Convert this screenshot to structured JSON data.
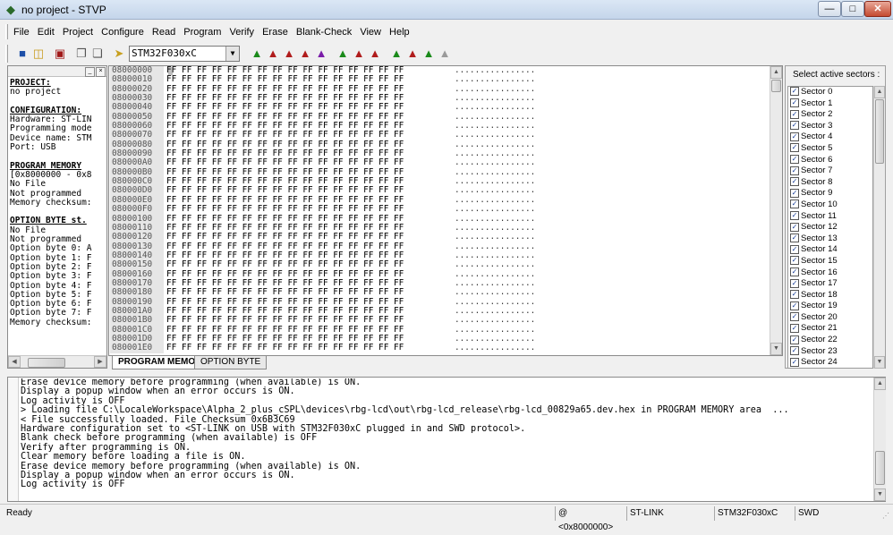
{
  "window": {
    "title": "no project - STVP"
  },
  "menu": [
    "File",
    "Edit",
    "Project",
    "Configure",
    "Read",
    "Program",
    "Verify",
    "Erase",
    "Blank-Check",
    "View",
    "Help"
  ],
  "toolbar": {
    "device": "STM32F030xC"
  },
  "icons": {
    "save": "save-icon",
    "open": "open-icon",
    "chip": "chip-icon",
    "copy": "copy-icon",
    "paste": "paste-icon",
    "connect": "connect-icon"
  },
  "left_panel": {
    "lines": [
      {
        "t": "PROJECT:",
        "h": true
      },
      {
        "t": "no project"
      },
      {
        "t": ""
      },
      {
        "t": "CONFIGURATION:",
        "h": true
      },
      {
        "t": "Hardware: ST-LIN"
      },
      {
        "t": "Programming mode"
      },
      {
        "t": "Device name: STM"
      },
      {
        "t": "Port: USB"
      },
      {
        "t": ""
      },
      {
        "t": "PROGRAM MEMORY",
        "h": true
      },
      {
        "t": "[0x8000000 - 0x8"
      },
      {
        "t": "No File"
      },
      {
        "t": "Not programmed"
      },
      {
        "t": "Memory checksum:"
      },
      {
        "t": ""
      },
      {
        "t": "OPTION BYTE st.",
        "h": true
      },
      {
        "t": "No File"
      },
      {
        "t": "Not programmed"
      },
      {
        "t": "Option byte 0: A"
      },
      {
        "t": "Option byte 1: F"
      },
      {
        "t": "Option byte 2: F"
      },
      {
        "t": "Option byte 3: F"
      },
      {
        "t": "Option byte 4: F"
      },
      {
        "t": "Option byte 5: F"
      },
      {
        "t": "Option byte 6: F"
      },
      {
        "t": "Option byte 7: F"
      },
      {
        "t": "Memory checksum:"
      }
    ]
  },
  "hex": {
    "addresses": [
      "08000000",
      "08000010",
      "08000020",
      "08000030",
      "08000040",
      "08000050",
      "08000060",
      "08000070",
      "08000080",
      "08000090",
      "080000A0",
      "080000B0",
      "080000C0",
      "080000D0",
      "080000E0",
      "080000F0",
      "08000100",
      "08000110",
      "08000120",
      "08000130",
      "08000140",
      "08000150",
      "08000160",
      "08000170",
      "08000180",
      "08000190",
      "080001A0",
      "080001B0",
      "080001C0",
      "080001D0",
      "080001E0"
    ],
    "data_line": "FF FF FF FF FF FF FF FF FF FF FF FF FF FF FF FF",
    "ascii_line": "................"
  },
  "tabs": [
    "PROGRAM MEMORY",
    "OPTION BYTE"
  ],
  "sectors": {
    "label": "Select active sectors :",
    "items": [
      "Sector 0",
      "Sector 1",
      "Sector 2",
      "Sector 3",
      "Sector 4",
      "Sector 5",
      "Sector 6",
      "Sector 7",
      "Sector 8",
      "Sector 9",
      "Sector 10",
      "Sector 11",
      "Sector 12",
      "Sector 13",
      "Sector 14",
      "Sector 15",
      "Sector 16",
      "Sector 17",
      "Sector 18",
      "Sector 19",
      "Sector 20",
      "Sector 21",
      "Sector 22",
      "Sector 23",
      "Sector 24"
    ]
  },
  "log": [
    "Erase device memory before programming (when available) is ON.",
    "Display a popup window when an error occurs is ON.",
    "Log activity is OFF",
    "> Loading file C:\\LocaleWorkspace\\Alpha_2_plus_cSPL\\devices\\rbg-lcd\\out\\rbg-lcd_release\\rbg-lcd_00829a65.dev.hex in PROGRAM MEMORY area  ...",
    "< File successfully loaded. File Checksum 0x6B3C69",
    "Hardware configuration set to <ST-LINK on USB with STM32F030xC plugged in and SWD protocol>.",
    "Blank check before programming (when available) is OFF",
    "Verify after programming is ON.",
    "Clear memory before loading a file is ON.",
    "Erase device memory before programming (when available) is ON.",
    "Display a popup window when an error occurs is ON.",
    "Log activity is OFF"
  ],
  "status": {
    "ready": "Ready",
    "address": "@ <0x8000000>",
    "hardware": "ST-LINK",
    "device": "STM32F030xC",
    "protocol": "SWD"
  }
}
